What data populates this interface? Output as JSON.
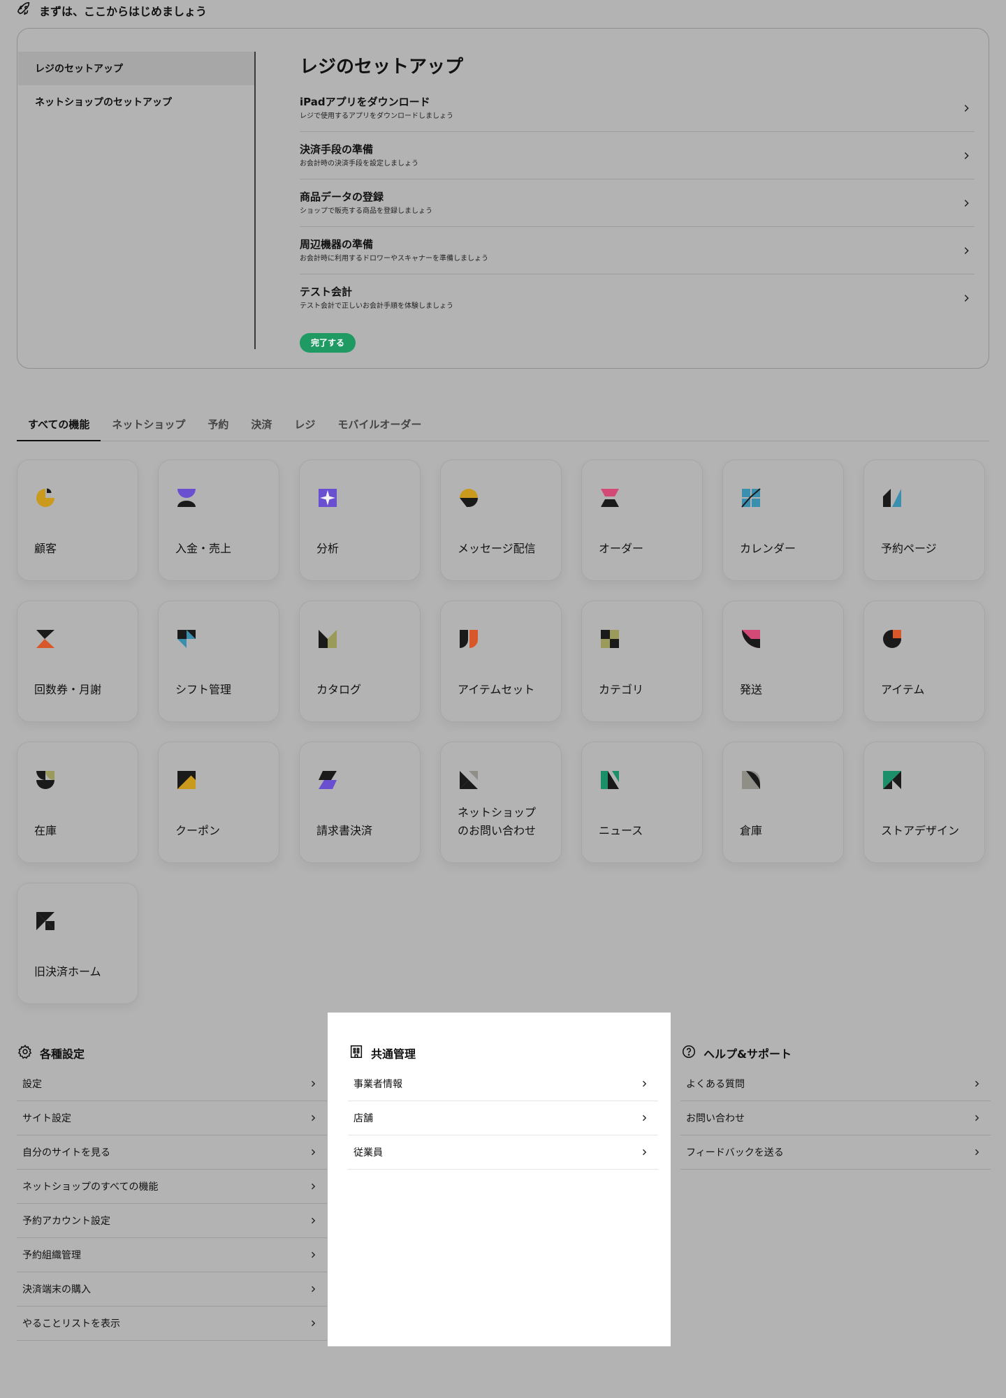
{
  "intro": {
    "heading": "まずは、ここからはじめましょう",
    "nav": [
      "レジのセットアップ",
      "ネットショップのセットアップ"
    ],
    "title": "レジのセットアップ",
    "steps": [
      {
        "title": "iPadアプリをダウンロード",
        "sub": "レジで使用するアプリをダウンロードしましょう"
      },
      {
        "title": "決済手段の準備",
        "sub": "お会計時の決済手段を設定しましょう"
      },
      {
        "title": "商品データの登録",
        "sub": "ショップで販売する商品を登録しましょう"
      },
      {
        "title": "周辺機器の準備",
        "sub": "お会計時に利用するドロワーやスキャナーを準備しましょう"
      },
      {
        "title": "テスト会計",
        "sub": "テスト会計で正しいお会計手順を体験しましょう"
      }
    ],
    "complete_label": "完了する",
    "complete_color": "#1f9a63"
  },
  "tabs": [
    "すべての機能",
    "ネットショップ",
    "予約",
    "決済",
    "レジ",
    "モバイルオーダー"
  ],
  "features": [
    {
      "label": "顧客",
      "icon": "customer-icon"
    },
    {
      "label": "入金・売上",
      "icon": "deposit-sales-icon"
    },
    {
      "label": "分析",
      "icon": "analytics-icon"
    },
    {
      "label": "メッセージ配信",
      "icon": "message-icon"
    },
    {
      "label": "オーダー",
      "icon": "order-icon"
    },
    {
      "label": "カレンダー",
      "icon": "calendar-icon"
    },
    {
      "label": "予約ページ",
      "icon": "booking-page-icon"
    },
    {
      "label": "回数券・月謝",
      "icon": "ticket-icon"
    },
    {
      "label": "シフト管理",
      "icon": "shift-icon"
    },
    {
      "label": "カタログ",
      "icon": "catalog-icon"
    },
    {
      "label": "アイテムセット",
      "icon": "item-set-icon"
    },
    {
      "label": "カテゴリ",
      "icon": "category-icon"
    },
    {
      "label": "発送",
      "icon": "shipping-icon"
    },
    {
      "label": "アイテム",
      "icon": "item-icon"
    },
    {
      "label": "在庫",
      "icon": "stock-icon"
    },
    {
      "label": "クーポン",
      "icon": "coupon-icon"
    },
    {
      "label": "請求書決済",
      "icon": "invoice-icon"
    },
    {
      "label": "ネットショップ\nのお問い合わせ",
      "icon": "shop-inquiry-icon"
    },
    {
      "label": "ニュース",
      "icon": "news-icon"
    },
    {
      "label": "倉庫",
      "icon": "warehouse-icon"
    },
    {
      "label": "ストアデザイン",
      "icon": "store-design-icon"
    },
    {
      "label": "旧決済ホーム",
      "icon": "old-payment-home-icon"
    }
  ],
  "settings": {
    "title": "各種設定",
    "items": [
      "設定",
      "サイト設定",
      "自分のサイトを見る",
      "ネットショップのすべての機能",
      "予約アカウント設定",
      "予約組織管理",
      "決済端末の購入",
      "やることリストを表示"
    ]
  },
  "common": {
    "title": "共通管理",
    "items": [
      "事業者情報",
      "店舗",
      "従業員"
    ]
  },
  "help": {
    "title": "ヘルプ&サポート",
    "items": [
      "よくある質問",
      "お問い合わせ",
      "フィードバックを送る"
    ]
  }
}
